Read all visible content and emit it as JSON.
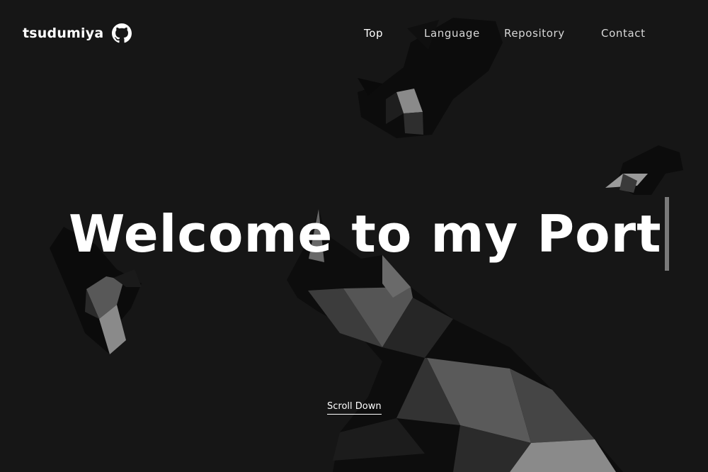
{
  "header": {
    "brand": "tsudumiya",
    "github_icon": "github-icon"
  },
  "nav": {
    "items": [
      {
        "label": "Top",
        "active": true
      },
      {
        "label": "Language",
        "active": false
      },
      {
        "label": "Repository",
        "active": false
      },
      {
        "label": "Contact",
        "active": false
      }
    ]
  },
  "hero": {
    "title": "Welcome to my Port"
  },
  "scroll": {
    "label": "Scroll Down"
  },
  "colors": {
    "background": "#161616",
    "text": "#ffffff",
    "nav_text": "#d8d8d8",
    "caret": "#7a7a7a"
  }
}
